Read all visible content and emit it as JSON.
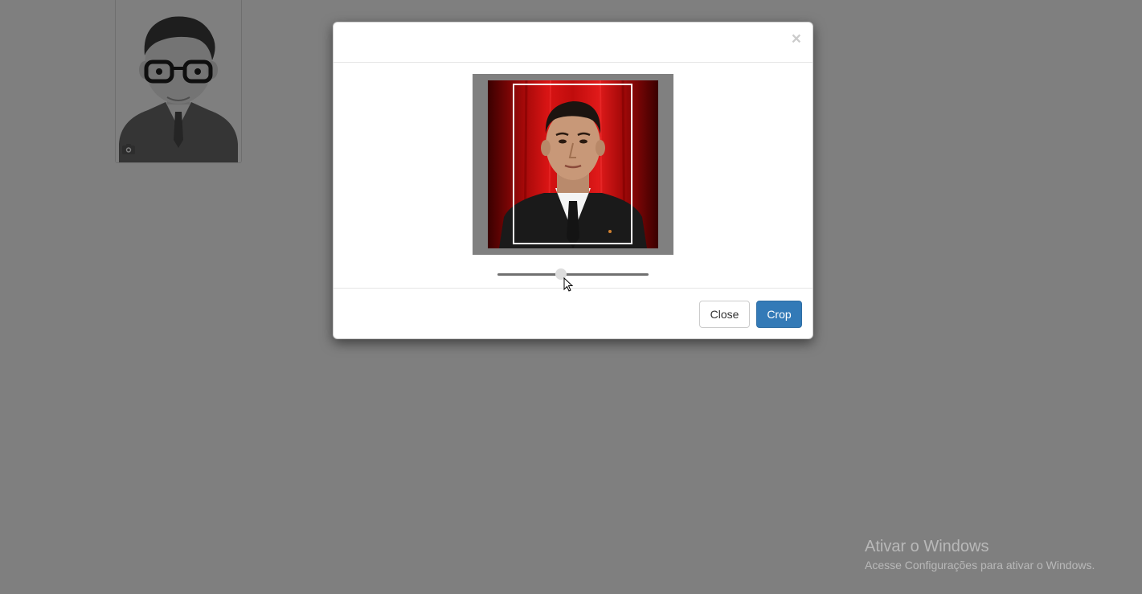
{
  "modal": {
    "close_symbol": "×",
    "zoom_slider": {
      "value_fraction": 0.42
    },
    "buttons": {
      "close_label": "Close",
      "crop_label": "Crop"
    },
    "colors": {
      "primary": "#337ab7",
      "overlay": "rgba(0,0,0,0.5)"
    }
  },
  "background": {
    "avatar_icon": "avatar-placeholder",
    "camera_icon": "camera-icon"
  },
  "watermark": {
    "title": "Ativar o Windows",
    "subtitle": "Acesse Configurações para ativar o Windows."
  }
}
